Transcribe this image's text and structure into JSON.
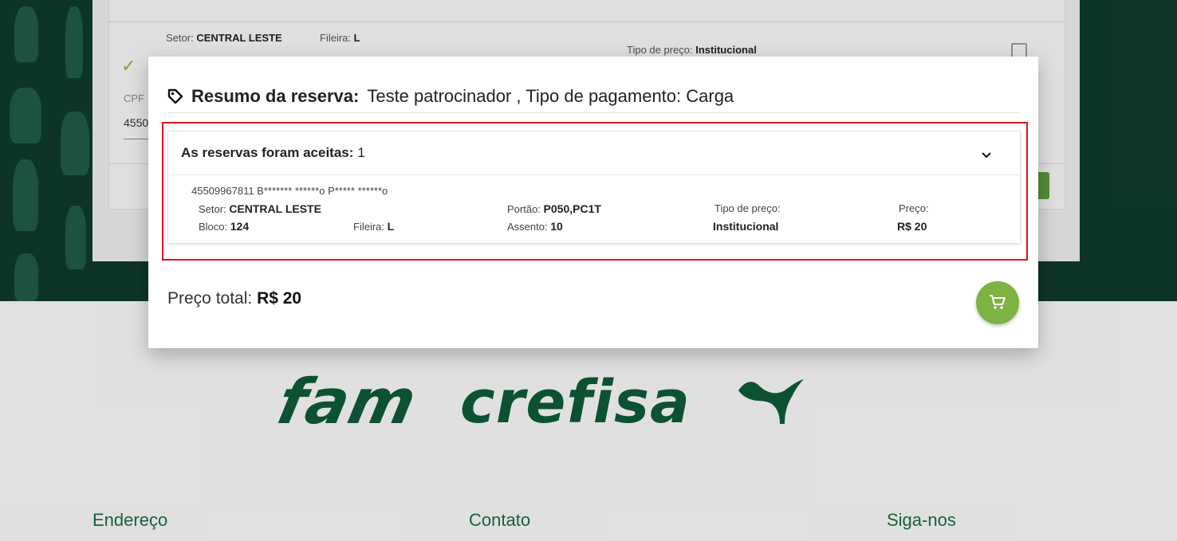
{
  "background": {
    "sector_label": "Setor:",
    "sector_value": "CENTRAL LESTE",
    "row_label": "Fileira:",
    "row_value": "L",
    "price_type_label": "Tipo de preço:",
    "price_type_value": "Institucional",
    "cpf_label": "CPF",
    "cpf_value": "4550"
  },
  "modal": {
    "title_bold": "Resumo da reserva:",
    "title_rest": "Teste patrocinador , Tipo de pagamento: Carga",
    "panel": {
      "header_bold": "As reservas foram aceitas:",
      "header_count": "1",
      "entry": {
        "holder": "45509967811 B******* ******o P***** ******o",
        "sector_label": "Setor:",
        "sector_value": "CENTRAL LESTE",
        "gate_label": "Portão:",
        "gate_value": "P050,PC1T",
        "price_type_label": "Tipo de preço:",
        "price_type_value": "Institucional",
        "price_label": "Preço:",
        "price_value": "R$ 20",
        "block_label": "Bloco:",
        "block_value": "124",
        "row_label": "Fileira:",
        "row_value": "L",
        "seat_label": "Assento:",
        "seat_value": "10"
      }
    },
    "total_label": "Preço total:",
    "total_value": "R$ 20",
    "cart_icon": "cart-icon",
    "accent_color": "#7cb342",
    "highlight_color": "#e0141e"
  },
  "footer": {
    "sponsors": [
      "fam",
      "crefisa"
    ],
    "puma_icon": "puma-logo",
    "columns": [
      "Endereço",
      "Contato",
      "Siga-nos"
    ]
  }
}
